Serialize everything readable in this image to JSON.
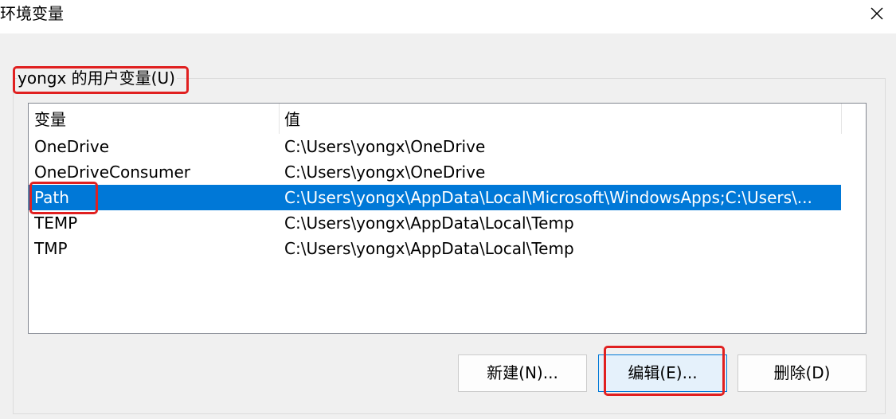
{
  "window": {
    "title": "环境变量",
    "close_icon": "close-icon"
  },
  "user_vars": {
    "group_label": "yongx 的用户变量(U)",
    "columns": [
      "变量",
      "值"
    ],
    "rows": [
      {
        "name": "OneDrive",
        "value": "C:\\Users\\yongx\\OneDrive"
      },
      {
        "name": "OneDriveConsumer",
        "value": "C:\\Users\\yongx\\OneDrive"
      },
      {
        "name": "Path",
        "value": "C:\\Users\\yongx\\AppData\\Local\\Microsoft\\WindowsApps;C:\\Users\\..."
      },
      {
        "name": "TEMP",
        "value": "C:\\Users\\yongx\\AppData\\Local\\Temp"
      },
      {
        "name": "TMP",
        "value": "C:\\Users\\yongx\\AppData\\Local\\Temp"
      }
    ],
    "selected_index": 2
  },
  "buttons": {
    "new_label": "新建(N)...",
    "edit_label": "编辑(E)...",
    "delete_label": "删除(D)"
  },
  "colors": {
    "selection": "#0078d7",
    "highlight": "#e02020"
  }
}
